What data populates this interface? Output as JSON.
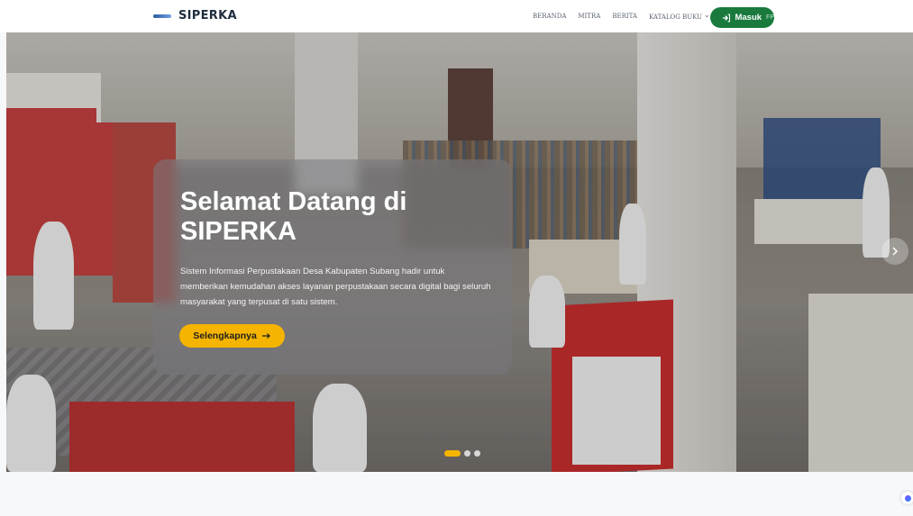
{
  "navbar": {
    "brand_name": "SIPERKA",
    "links": [
      "BERANDA",
      "MITRA",
      "BERITA",
      "KATALOG BUKU"
    ],
    "login_label": "Masuk",
    "login_icon": "login-arrow-icon",
    "login_extra": "FP"
  },
  "hero": {
    "title": "Selamat Datang di SIPERKA",
    "description": "Sistem Informasi Perpustakaan Desa Kabupaten Subang hadir untuk memberikan kemudahan akses layanan perpustakaan secara digital bagi seluruh masyarakat yang terpusat di satu sistem.",
    "cta_label": "Selengkapnya",
    "cta_icon": "arrow-right-icon",
    "next_icon": "chevron-right-icon",
    "slides_total": 3,
    "active_slide": 1
  },
  "colors": {
    "accent_yellow": "#f5b400",
    "login_green": "#1a7a3e"
  }
}
